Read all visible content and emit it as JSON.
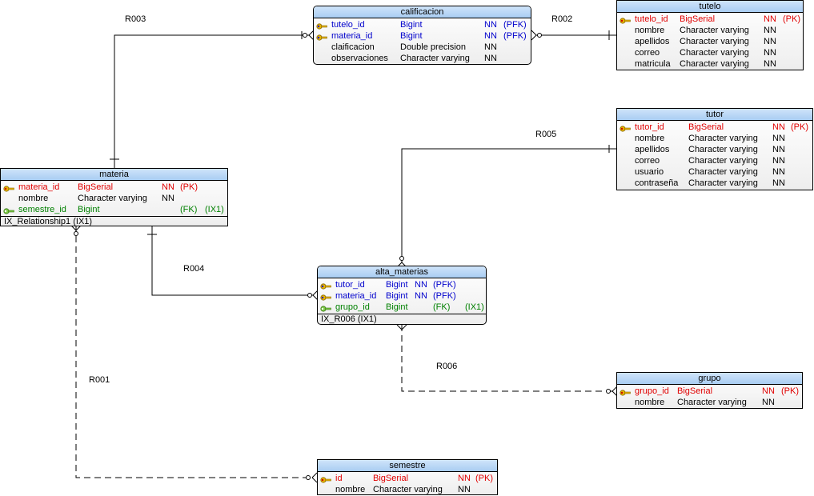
{
  "colors": {
    "pk": "#e00000",
    "pfk": "#0000cc",
    "fk": "#008000",
    "plain": "#000000",
    "header": "#b8d6f5"
  },
  "entities": {
    "calificacion": {
      "title": "calificacion",
      "rows": [
        {
          "kind": "pfk",
          "name": "tutelo_id",
          "type": "Bigint",
          "nn": "NN",
          "key": "(PFK)",
          "idx": ""
        },
        {
          "kind": "pfk",
          "name": "materia_id",
          "type": "Bigint",
          "nn": "NN",
          "key": "(PFK)",
          "idx": ""
        },
        {
          "kind": "plain",
          "name": "claificacion",
          "type": "Double precision",
          "nn": "NN",
          "key": "",
          "idx": ""
        },
        {
          "kind": "plain",
          "name": "observaciones",
          "type": "Character varying",
          "nn": "NN",
          "key": "",
          "idx": ""
        }
      ]
    },
    "tutelo": {
      "title": "tutelo",
      "rows": [
        {
          "kind": "pk",
          "name": "tutelo_id",
          "type": "BigSerial",
          "nn": "NN",
          "key": "(PK)",
          "idx": ""
        },
        {
          "kind": "plain",
          "name": "nombre",
          "type": "Character varying",
          "nn": "NN",
          "key": "",
          "idx": ""
        },
        {
          "kind": "plain",
          "name": "apellidos",
          "type": "Character varying",
          "nn": "NN",
          "key": "",
          "idx": ""
        },
        {
          "kind": "plain",
          "name": "correo",
          "type": "Character varying",
          "nn": "NN",
          "key": "",
          "idx": ""
        },
        {
          "kind": "plain",
          "name": "matricula",
          "type": "Character varying",
          "nn": "NN",
          "key": "",
          "idx": ""
        }
      ]
    },
    "tutor": {
      "title": "tutor",
      "rows": [
        {
          "kind": "pk",
          "name": "tutor_id",
          "type": "BigSerial",
          "nn": "NN",
          "key": "(PK)",
          "idx": ""
        },
        {
          "kind": "plain",
          "name": "nombre",
          "type": "Character varying",
          "nn": "NN",
          "key": "",
          "idx": ""
        },
        {
          "kind": "plain",
          "name": "apellidos",
          "type": "Character varying",
          "nn": "NN",
          "key": "",
          "idx": ""
        },
        {
          "kind": "plain",
          "name": "correo",
          "type": "Character varying",
          "nn": "NN",
          "key": "",
          "idx": ""
        },
        {
          "kind": "plain",
          "name": "usuario",
          "type": "Character varying",
          "nn": "NN",
          "key": "",
          "idx": ""
        },
        {
          "kind": "plain",
          "name": "contraseña",
          "type": "Character varying",
          "nn": "NN",
          "key": "",
          "idx": ""
        }
      ]
    },
    "materia": {
      "title": "materia",
      "rows": [
        {
          "kind": "pk",
          "name": "materia_id",
          "type": "BigSerial",
          "nn": "NN",
          "key": "(PK)",
          "idx": ""
        },
        {
          "kind": "plain",
          "name": "nombre",
          "type": "Character varying",
          "nn": "NN",
          "key": "",
          "idx": ""
        },
        {
          "kind": "fk",
          "name": "semestre_id",
          "type": "Bigint",
          "nn": "",
          "key": "(FK)",
          "idx": "(IX1)"
        }
      ],
      "index": "IX_Relationship1 (IX1)"
    },
    "alta_materias": {
      "title": "alta_materias",
      "rows": [
        {
          "kind": "pfk",
          "name": "tutor_id",
          "type": "Bigint",
          "nn": "NN",
          "key": "(PFK)",
          "idx": ""
        },
        {
          "kind": "pfk",
          "name": "materia_id",
          "type": "Bigint",
          "nn": "NN",
          "key": "(PFK)",
          "idx": ""
        },
        {
          "kind": "fk",
          "name": "grupo_id",
          "type": "Bigint",
          "nn": "",
          "key": "(FK)",
          "idx": "(IX1)"
        }
      ],
      "index": "IX_R006 (IX1)"
    },
    "grupo": {
      "title": "grupo",
      "rows": [
        {
          "kind": "pk",
          "name": "grupo_id",
          "type": "BigSerial",
          "nn": "NN",
          "key": "(PK)",
          "idx": ""
        },
        {
          "kind": "plain",
          "name": "nombre",
          "type": "Character varying",
          "nn": "NN",
          "key": "",
          "idx": ""
        }
      ]
    },
    "semestre": {
      "title": "semestre",
      "rows": [
        {
          "kind": "pk",
          "name": "id",
          "type": "BigSerial",
          "nn": "NN",
          "key": "(PK)",
          "idx": ""
        },
        {
          "kind": "plain",
          "name": "nombre",
          "type": "Character varying",
          "nn": "NN",
          "key": "",
          "idx": ""
        }
      ]
    }
  },
  "relationships": {
    "R001": "R001",
    "R002": "R002",
    "R003": "R003",
    "R004": "R004",
    "R005": "R005",
    "R006": "R006"
  }
}
